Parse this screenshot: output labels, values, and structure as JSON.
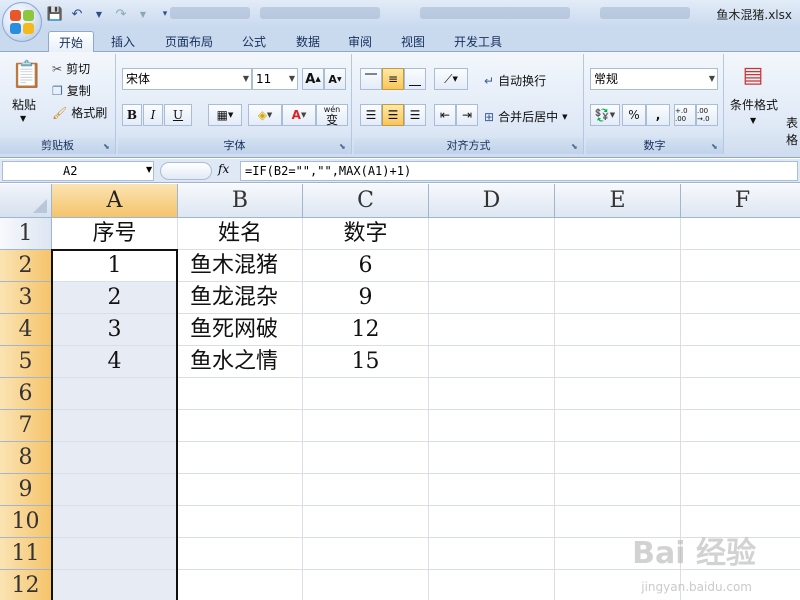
{
  "window": {
    "title": "鱼木混猪.xlsx"
  },
  "tabs": [
    "开始",
    "插入",
    "页面布局",
    "公式",
    "数据",
    "审阅",
    "视图",
    "开发工具"
  ],
  "clipboard": {
    "paste": "粘贴",
    "cut": "剪切",
    "copy": "复制",
    "format_painter": "格式刷",
    "label": "剪贴板"
  },
  "font": {
    "name": "宋体",
    "size": "11",
    "bold": "B",
    "italic": "I",
    "underline": "U",
    "wen": "wén",
    "wen_char": "变",
    "label": "字体"
  },
  "alignment": {
    "wrap_text": "自动换行",
    "merge_center": "合并后居中",
    "label": "对齐方式"
  },
  "number": {
    "format": "常规",
    "percent": "%",
    "comma": ",",
    "inc_decimal": "+.0 .00",
    "dec_decimal": ".00 →.0",
    "label": "数字"
  },
  "styles": {
    "conditional_format": "条件格式",
    "table_partial": "表格"
  },
  "formula_bar": {
    "name_box": "A2",
    "fx": "fx",
    "formula": "=IF(B2=\"\",\"\",MAX(A1)+1)"
  },
  "columns": [
    "A",
    "B",
    "C",
    "D",
    "E",
    "F"
  ],
  "rows": [
    "1",
    "2",
    "3",
    "4",
    "5",
    "6",
    "7",
    "8",
    "9",
    "10",
    "11",
    "12"
  ],
  "table": {
    "headers": [
      "序号",
      "姓名",
      "数字"
    ],
    "data": [
      [
        "1",
        "鱼木混猪",
        "6"
      ],
      [
        "2",
        "鱼龙混杂",
        "9"
      ],
      [
        "3",
        "鱼死网破",
        "12"
      ],
      [
        "4",
        "鱼水之情",
        "15"
      ]
    ]
  },
  "watermark": {
    "main": "Bai 经验",
    "sub": "jingyan.baidu.com"
  },
  "colors": {
    "selected_header": "#f5c46a",
    "selection_fill": "#e6ebf4",
    "ribbon_bg": "#dfe9f6"
  }
}
